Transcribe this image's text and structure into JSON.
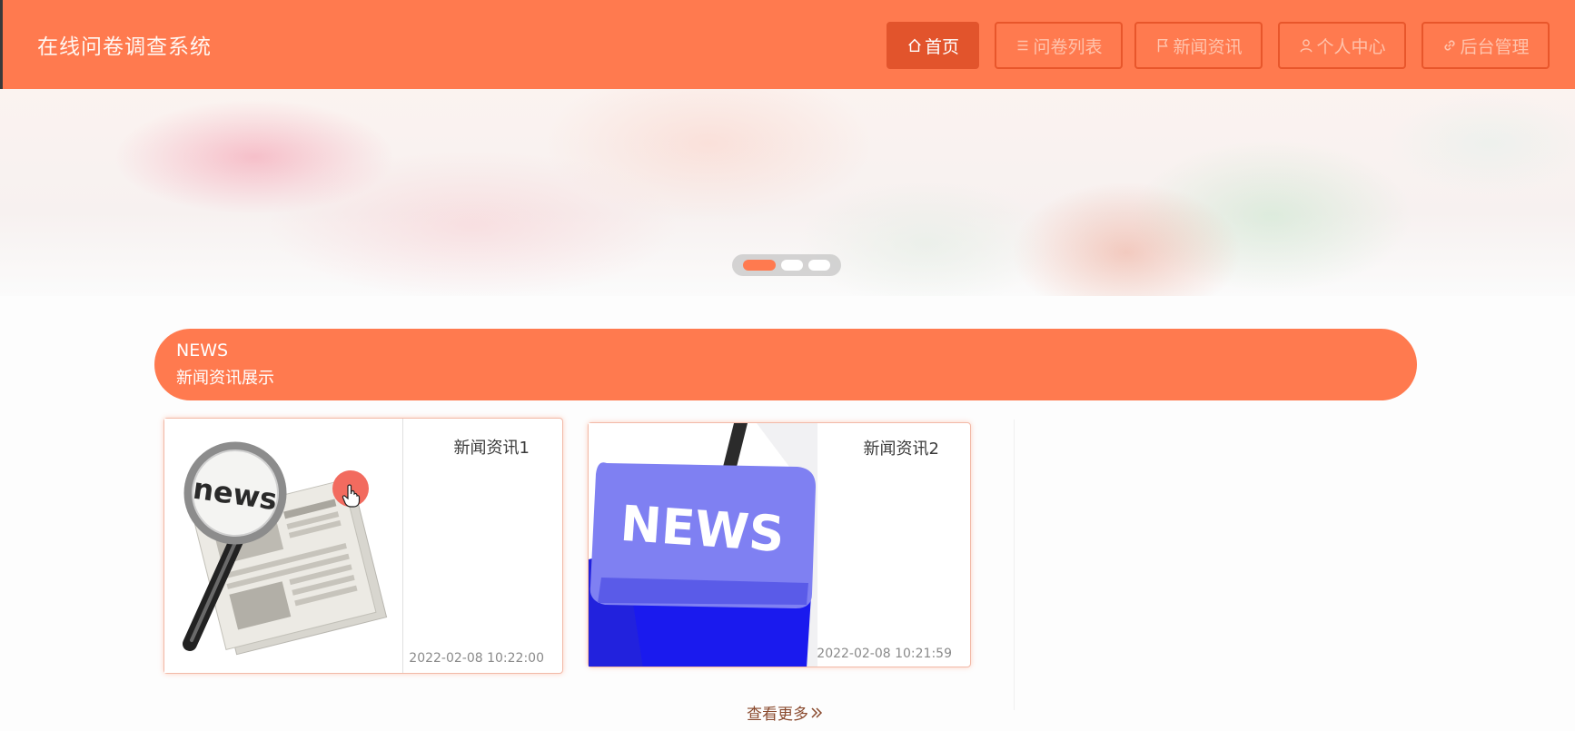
{
  "app": {
    "title": "在线问卷调查系统"
  },
  "nav": {
    "items": [
      {
        "label": "首页",
        "icon": "home-icon",
        "active": true
      },
      {
        "label": "问卷列表",
        "icon": "list-icon",
        "active": false
      },
      {
        "label": "新闻资讯",
        "icon": "flag-icon",
        "active": false
      },
      {
        "label": "个人中心",
        "icon": "user-icon",
        "active": false
      },
      {
        "label": "后台管理",
        "icon": "link-icon",
        "active": false
      }
    ]
  },
  "banner": {
    "slide_count": 3,
    "active_slide": 1
  },
  "news_section": {
    "title": "NEWS",
    "subtitle": "新闻资讯展示",
    "items": [
      {
        "title": "新闻资讯1",
        "date": "2022-02-08 10:22:00",
        "image": "magnifier-newspaper-image"
      },
      {
        "title": "新闻资讯2",
        "date": "2022-02-08 10:21:59",
        "image": "news-key-image"
      }
    ],
    "more_label": "查看更多"
  },
  "colors": {
    "primary": "#ff7a4f",
    "primary_dark": "#e2542c",
    "text": "#3a3a3a",
    "muted": "#8a8a8a"
  }
}
